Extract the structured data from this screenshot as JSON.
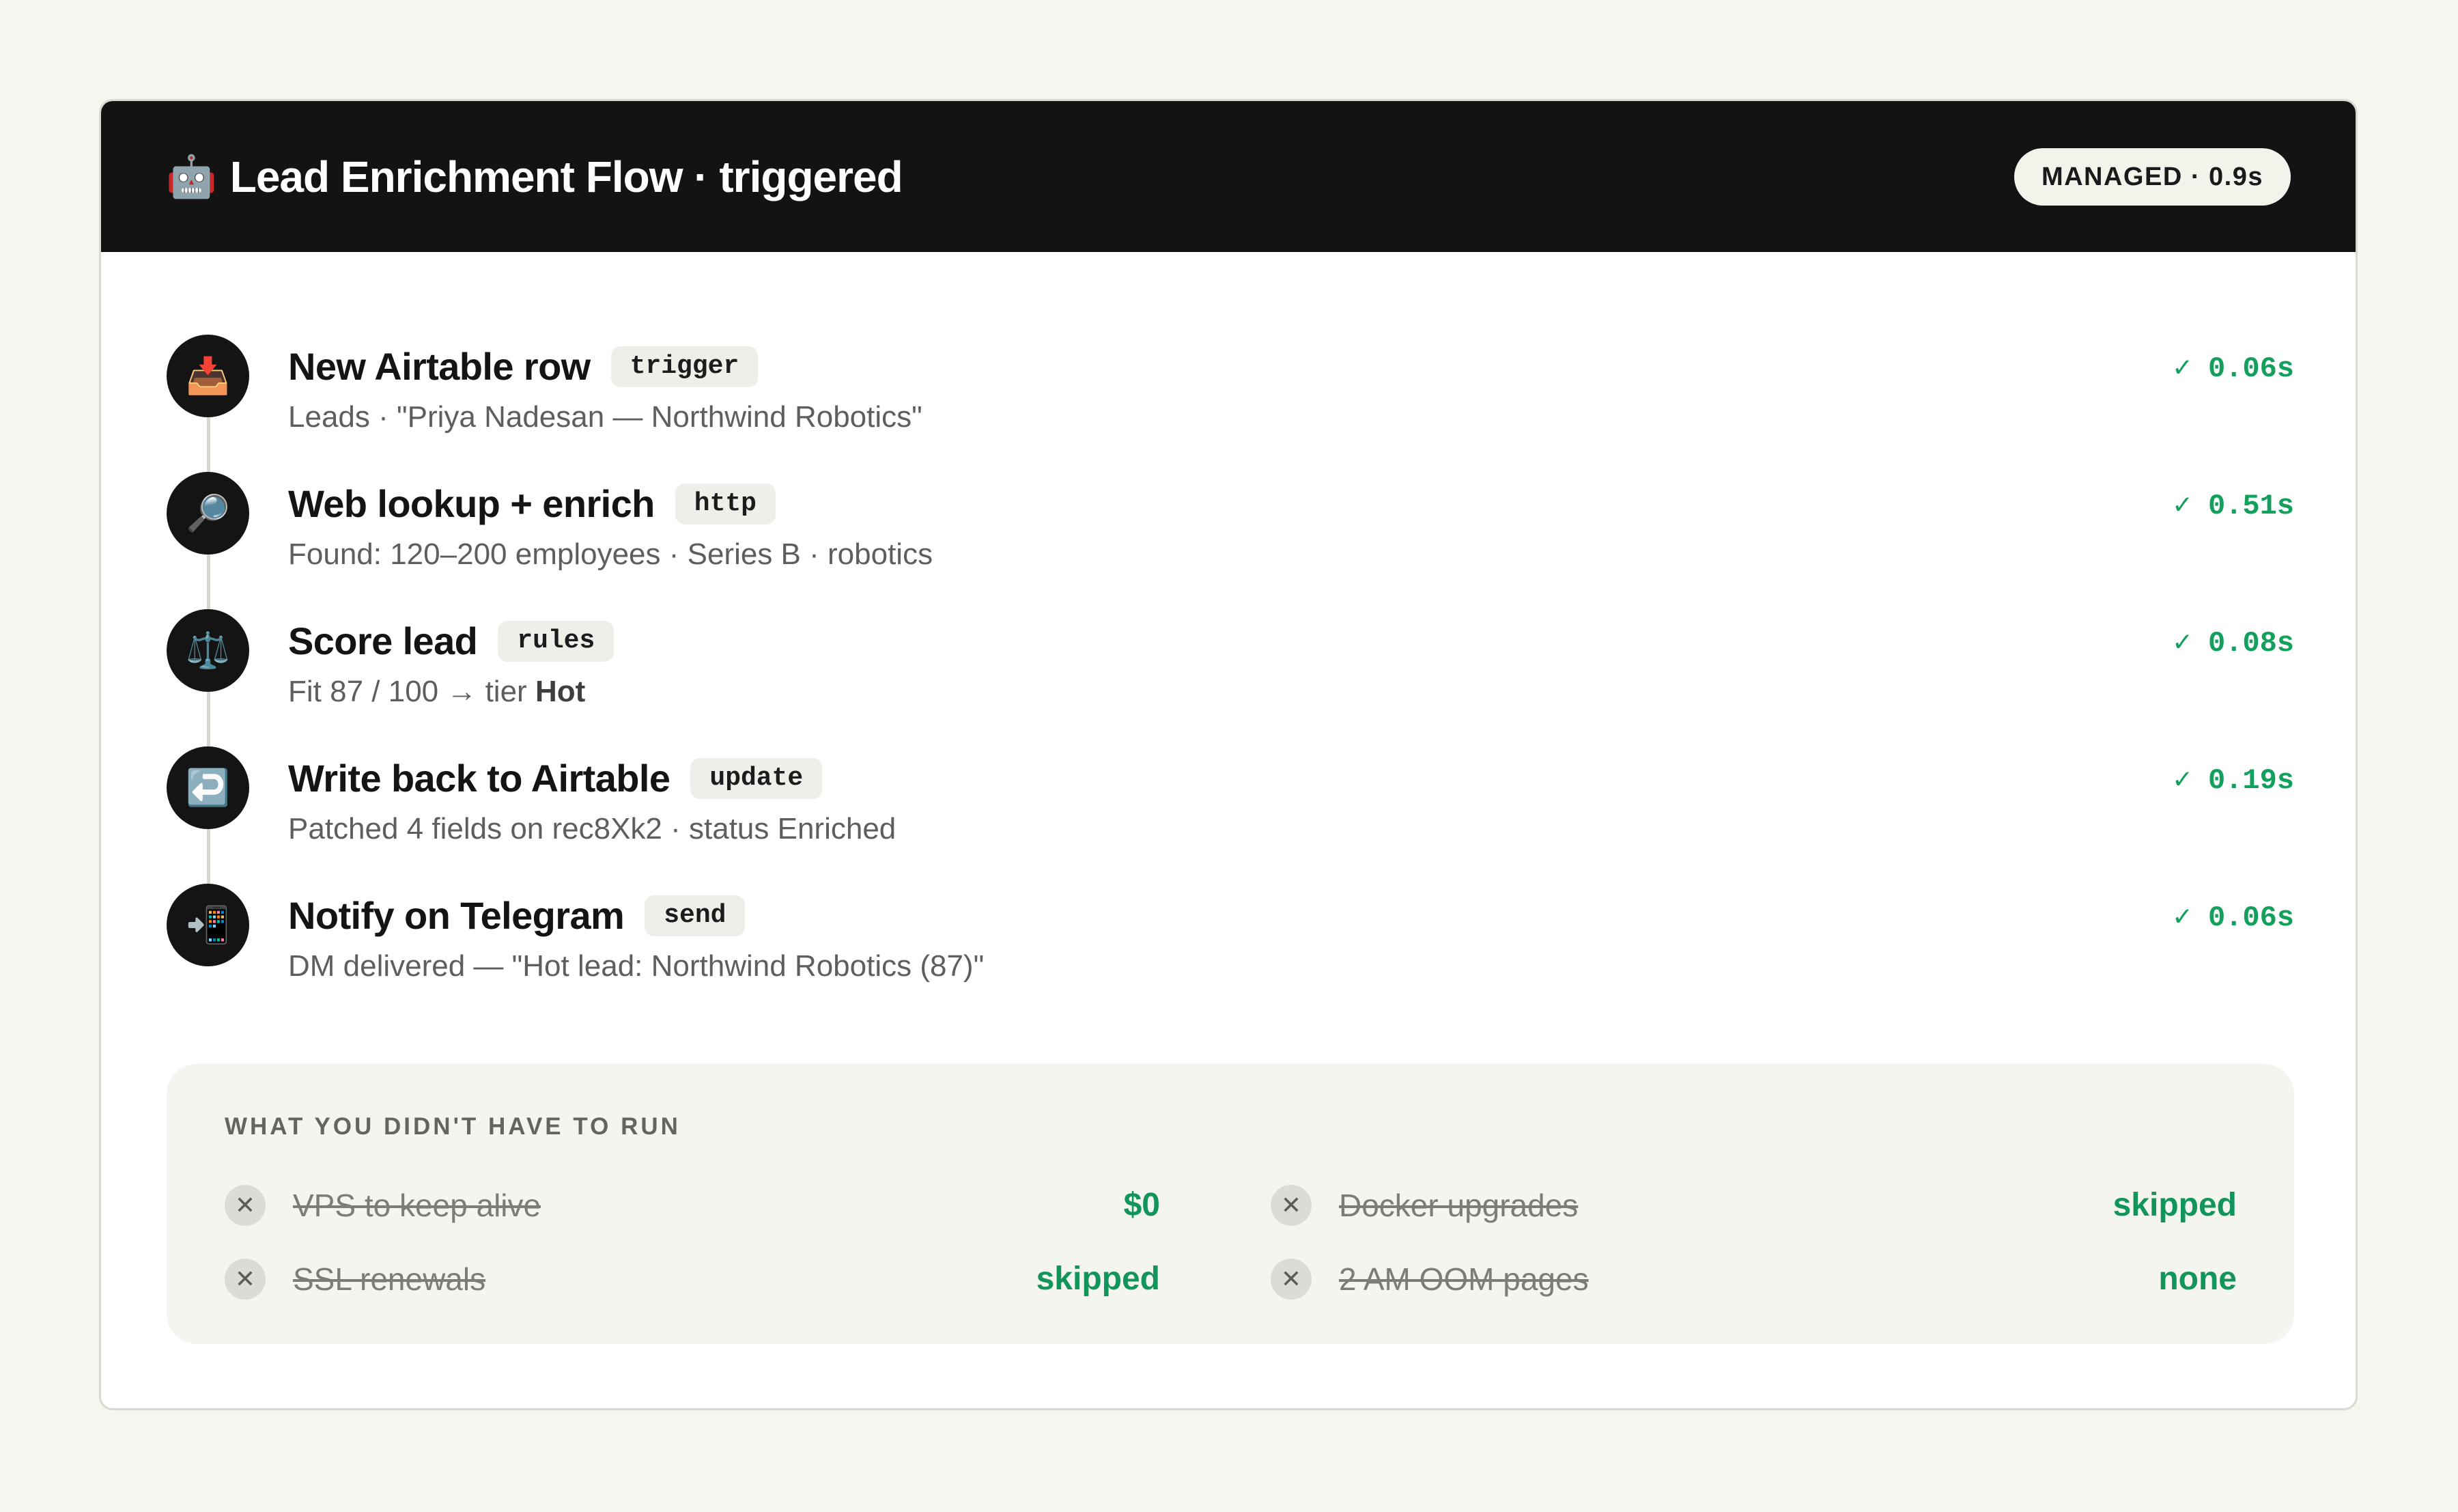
{
  "header": {
    "emoji": "🤖",
    "title": "Lead Enrichment Flow · triggered",
    "badge": "MANAGED · 0.9s"
  },
  "steps": [
    {
      "icon": "📥",
      "icon_name": "inbox-tray-icon",
      "title": "New Airtable row",
      "tag": "trigger",
      "desc": "Leads · \"Priya Nadesan — Northwind Robotics\"",
      "time": "✓ 0.06s"
    },
    {
      "icon": "🔎",
      "icon_name": "magnifying-glass-icon",
      "title": "Web lookup + enrich",
      "tag": "http",
      "desc": "Found: 120–200 employees · Series B · robotics",
      "time": "✓ 0.51s"
    },
    {
      "icon": "⚖️",
      "icon_name": "balance-scale-icon",
      "title": "Score lead",
      "tag": "rules",
      "desc_prefix": "Fit 87 / 100 → tier ",
      "desc_strong": "Hot",
      "time": "✓ 0.08s"
    },
    {
      "icon": "↩️",
      "icon_name": "return-arrow-icon",
      "title": "Write back to Airtable",
      "tag": "update",
      "desc": "Patched 4 fields on rec8Xk2 · status Enriched",
      "time": "✓ 0.19s"
    },
    {
      "icon": "📲",
      "icon_name": "mobile-phone-arrow-icon",
      "title": "Notify on Telegram",
      "tag": "send",
      "desc": "DM delivered — \"Hot lead: Northwind Robotics (87)\"",
      "time": "✓ 0.06s"
    }
  ],
  "panel": {
    "title": "WHAT YOU DIDN'T HAVE TO RUN",
    "x_icon": "✕",
    "items": [
      {
        "label": "VPS to keep alive",
        "value": "$0"
      },
      {
        "label": "Docker upgrades",
        "value": "skipped"
      },
      {
        "label": "SSL renewals",
        "value": "skipped"
      },
      {
        "label": "2 AM OOM pages",
        "value": "none"
      }
    ]
  },
  "colors": {
    "background": "#f6f5f0",
    "header": "#131313",
    "success": "#12a05c",
    "panel": "#f5f5f0"
  }
}
